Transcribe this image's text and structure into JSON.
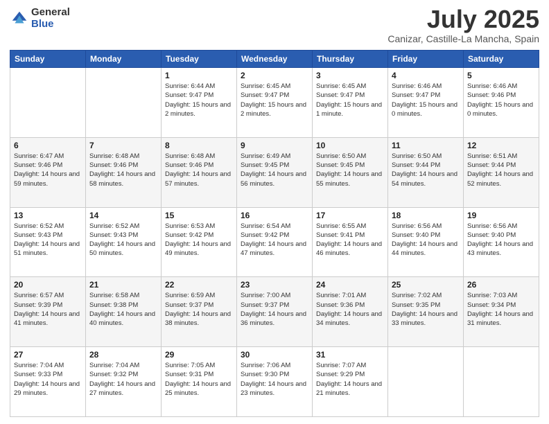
{
  "logo": {
    "general": "General",
    "blue": "Blue"
  },
  "title": {
    "month": "July 2025",
    "location": "Canizar, Castille-La Mancha, Spain"
  },
  "days_of_week": [
    "Sunday",
    "Monday",
    "Tuesday",
    "Wednesday",
    "Thursday",
    "Friday",
    "Saturday"
  ],
  "weeks": [
    [
      {
        "day": "",
        "info": ""
      },
      {
        "day": "",
        "info": ""
      },
      {
        "day": "1",
        "info": "Sunrise: 6:44 AM\nSunset: 9:47 PM\nDaylight: 15 hours\nand 2 minutes."
      },
      {
        "day": "2",
        "info": "Sunrise: 6:45 AM\nSunset: 9:47 PM\nDaylight: 15 hours\nand 2 minutes."
      },
      {
        "day": "3",
        "info": "Sunrise: 6:45 AM\nSunset: 9:47 PM\nDaylight: 15 hours\nand 1 minute."
      },
      {
        "day": "4",
        "info": "Sunrise: 6:46 AM\nSunset: 9:47 PM\nDaylight: 15 hours\nand 0 minutes."
      },
      {
        "day": "5",
        "info": "Sunrise: 6:46 AM\nSunset: 9:46 PM\nDaylight: 15 hours\nand 0 minutes."
      }
    ],
    [
      {
        "day": "6",
        "info": "Sunrise: 6:47 AM\nSunset: 9:46 PM\nDaylight: 14 hours\nand 59 minutes."
      },
      {
        "day": "7",
        "info": "Sunrise: 6:48 AM\nSunset: 9:46 PM\nDaylight: 14 hours\nand 58 minutes."
      },
      {
        "day": "8",
        "info": "Sunrise: 6:48 AM\nSunset: 9:46 PM\nDaylight: 14 hours\nand 57 minutes."
      },
      {
        "day": "9",
        "info": "Sunrise: 6:49 AM\nSunset: 9:45 PM\nDaylight: 14 hours\nand 56 minutes."
      },
      {
        "day": "10",
        "info": "Sunrise: 6:50 AM\nSunset: 9:45 PM\nDaylight: 14 hours\nand 55 minutes."
      },
      {
        "day": "11",
        "info": "Sunrise: 6:50 AM\nSunset: 9:44 PM\nDaylight: 14 hours\nand 54 minutes."
      },
      {
        "day": "12",
        "info": "Sunrise: 6:51 AM\nSunset: 9:44 PM\nDaylight: 14 hours\nand 52 minutes."
      }
    ],
    [
      {
        "day": "13",
        "info": "Sunrise: 6:52 AM\nSunset: 9:43 PM\nDaylight: 14 hours\nand 51 minutes."
      },
      {
        "day": "14",
        "info": "Sunrise: 6:52 AM\nSunset: 9:43 PM\nDaylight: 14 hours\nand 50 minutes."
      },
      {
        "day": "15",
        "info": "Sunrise: 6:53 AM\nSunset: 9:42 PM\nDaylight: 14 hours\nand 49 minutes."
      },
      {
        "day": "16",
        "info": "Sunrise: 6:54 AM\nSunset: 9:42 PM\nDaylight: 14 hours\nand 47 minutes."
      },
      {
        "day": "17",
        "info": "Sunrise: 6:55 AM\nSunset: 9:41 PM\nDaylight: 14 hours\nand 46 minutes."
      },
      {
        "day": "18",
        "info": "Sunrise: 6:56 AM\nSunset: 9:40 PM\nDaylight: 14 hours\nand 44 minutes."
      },
      {
        "day": "19",
        "info": "Sunrise: 6:56 AM\nSunset: 9:40 PM\nDaylight: 14 hours\nand 43 minutes."
      }
    ],
    [
      {
        "day": "20",
        "info": "Sunrise: 6:57 AM\nSunset: 9:39 PM\nDaylight: 14 hours\nand 41 minutes."
      },
      {
        "day": "21",
        "info": "Sunrise: 6:58 AM\nSunset: 9:38 PM\nDaylight: 14 hours\nand 40 minutes."
      },
      {
        "day": "22",
        "info": "Sunrise: 6:59 AM\nSunset: 9:37 PM\nDaylight: 14 hours\nand 38 minutes."
      },
      {
        "day": "23",
        "info": "Sunrise: 7:00 AM\nSunset: 9:37 PM\nDaylight: 14 hours\nand 36 minutes."
      },
      {
        "day": "24",
        "info": "Sunrise: 7:01 AM\nSunset: 9:36 PM\nDaylight: 14 hours\nand 34 minutes."
      },
      {
        "day": "25",
        "info": "Sunrise: 7:02 AM\nSunset: 9:35 PM\nDaylight: 14 hours\nand 33 minutes."
      },
      {
        "day": "26",
        "info": "Sunrise: 7:03 AM\nSunset: 9:34 PM\nDaylight: 14 hours\nand 31 minutes."
      }
    ],
    [
      {
        "day": "27",
        "info": "Sunrise: 7:04 AM\nSunset: 9:33 PM\nDaylight: 14 hours\nand 29 minutes."
      },
      {
        "day": "28",
        "info": "Sunrise: 7:04 AM\nSunset: 9:32 PM\nDaylight: 14 hours\nand 27 minutes."
      },
      {
        "day": "29",
        "info": "Sunrise: 7:05 AM\nSunset: 9:31 PM\nDaylight: 14 hours\nand 25 minutes."
      },
      {
        "day": "30",
        "info": "Sunrise: 7:06 AM\nSunset: 9:30 PM\nDaylight: 14 hours\nand 23 minutes."
      },
      {
        "day": "31",
        "info": "Sunrise: 7:07 AM\nSunset: 9:29 PM\nDaylight: 14 hours\nand 21 minutes."
      },
      {
        "day": "",
        "info": ""
      },
      {
        "day": "",
        "info": ""
      }
    ]
  ]
}
